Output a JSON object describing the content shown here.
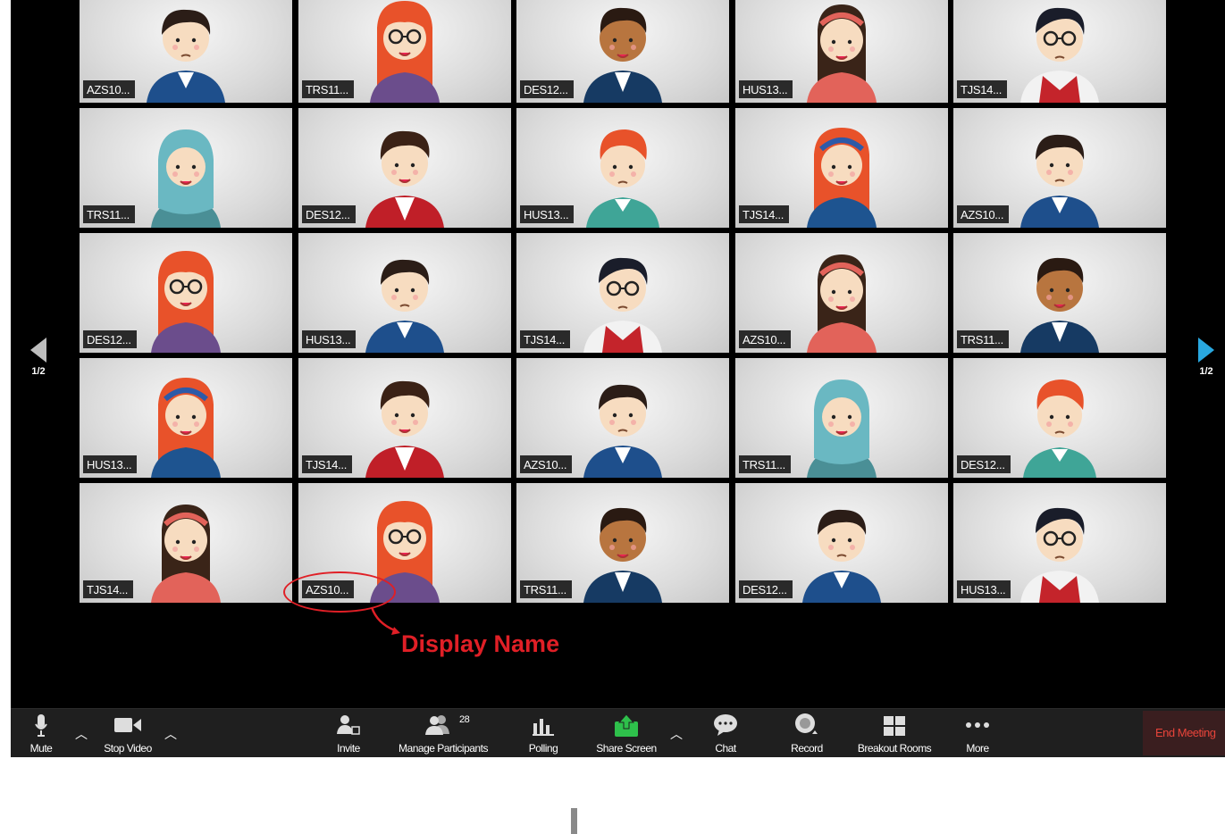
{
  "participants": [
    {
      "name": "AZS10...",
      "avatar": "boy-blue-jacket"
    },
    {
      "name": "TRS11...",
      "avatar": "girl-red-hair-glasses"
    },
    {
      "name": "DES12...",
      "avatar": "boy-dark-skin"
    },
    {
      "name": "HUS13...",
      "avatar": "girl-headband"
    },
    {
      "name": "TJS14...",
      "avatar": "boy-glasses-red-vest"
    },
    {
      "name": "TRS11...",
      "avatar": "girl-hijab"
    },
    {
      "name": "DES12...",
      "avatar": "boy-red-jacket"
    },
    {
      "name": "HUS13...",
      "avatar": "boy-orange-hair"
    },
    {
      "name": "TJS14...",
      "avatar": "girl-red-hair-headband"
    },
    {
      "name": "AZS10...",
      "avatar": "boy-blue-jacket"
    },
    {
      "name": "DES12...",
      "avatar": "girl-red-hair-glasses"
    },
    {
      "name": "HUS13...",
      "avatar": "boy-blue-jacket"
    },
    {
      "name": "TJS14...",
      "avatar": "boy-glasses-red-vest"
    },
    {
      "name": "AZS10...",
      "avatar": "girl-headband"
    },
    {
      "name": "TRS11...",
      "avatar": "boy-dark-skin"
    },
    {
      "name": "HUS13...",
      "avatar": "girl-red-hair-headband"
    },
    {
      "name": "TJS14...",
      "avatar": "boy-red-jacket"
    },
    {
      "name": "AZS10...",
      "avatar": "boy-blue-jacket"
    },
    {
      "name": "TRS11...",
      "avatar": "girl-hijab"
    },
    {
      "name": "DES12...",
      "avatar": "boy-orange-hair"
    },
    {
      "name": "TJS14...",
      "avatar": "girl-headband"
    },
    {
      "name": "AZS10...",
      "avatar": "girl-red-hair-glasses"
    },
    {
      "name": "TRS11...",
      "avatar": "boy-dark-skin"
    },
    {
      "name": "DES12...",
      "avatar": "boy-blue-jacket"
    },
    {
      "name": "HUS13...",
      "avatar": "boy-glasses-red-vest"
    }
  ],
  "pagination": {
    "left": "1/2",
    "right": "1/2"
  },
  "annotation": {
    "label": "Display Name"
  },
  "toolbar": {
    "mute": "Mute",
    "stop_video": "Stop Video",
    "invite": "Invite",
    "manage_participants": "Manage Participants",
    "participant_count": "28",
    "polling": "Polling",
    "share_screen": "Share Screen",
    "chat": "Chat",
    "record": "Record",
    "breakout_rooms": "Breakout Rooms",
    "more": "More",
    "end_meeting": "End Meeting"
  },
  "colors": {
    "end_meeting": "#e8443a",
    "annotation": "#e01f26",
    "share_screen": "#2ec04b"
  }
}
